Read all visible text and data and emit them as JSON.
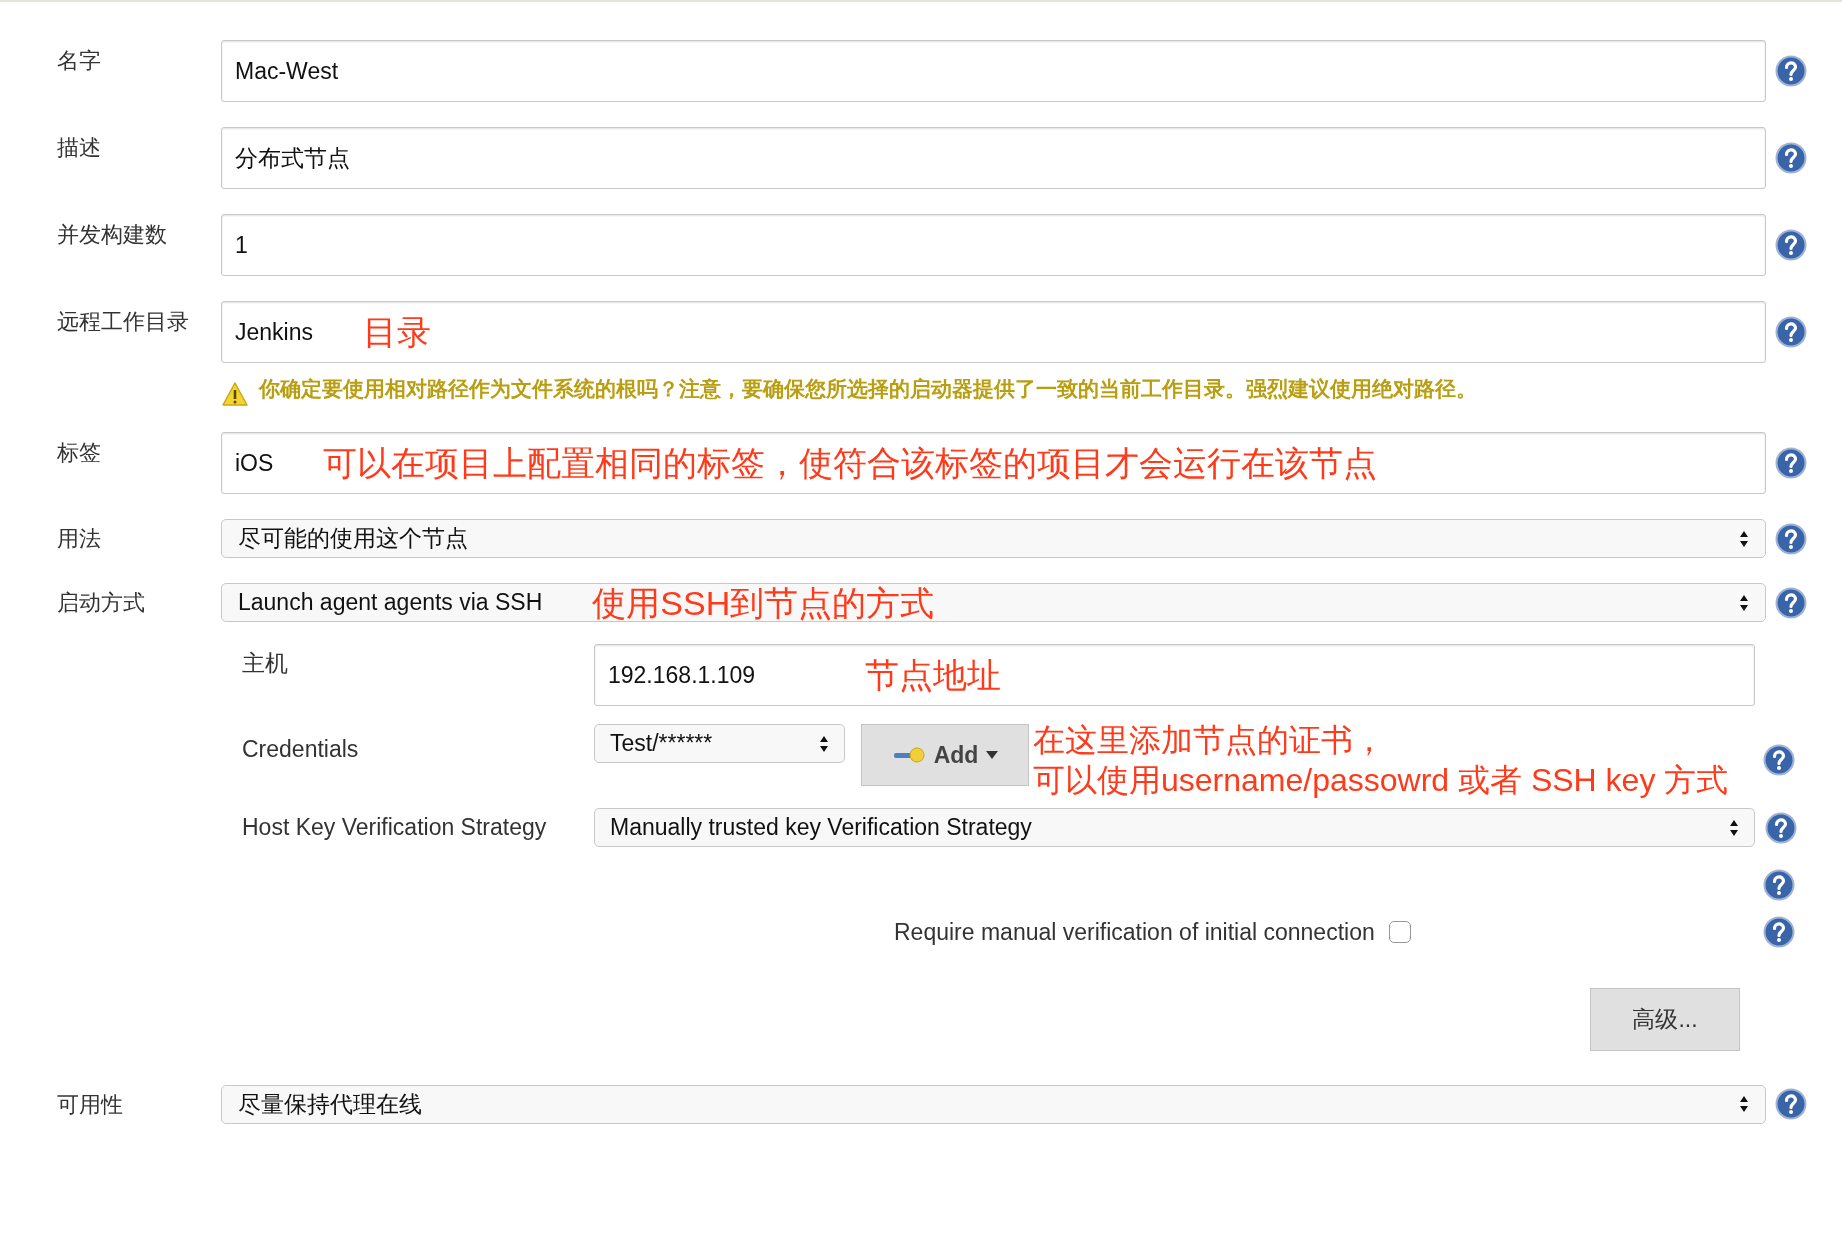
{
  "fields": [
    {
      "label": "名字",
      "kind": "text",
      "value": "Mac-West"
    },
    {
      "label": "描述",
      "kind": "text",
      "value": "分布式节点"
    },
    {
      "label": "并发构建数",
      "kind": "text",
      "value": "1"
    },
    {
      "label": "远程工作目录",
      "kind": "text",
      "value": "Jenkins",
      "annotation": "目录",
      "warning": "你确定要使用相对路径作为文件系统的根吗？注意，要确保您所选择的启动器提供了一致的当前工作目录。强烈建议使用绝对路径。"
    },
    {
      "label": "标签",
      "kind": "text",
      "value": "iOS",
      "annotation": "可以在项目上配置相同的标签，使符合该标签的项目才会运行在该节点"
    },
    {
      "label": "用法",
      "kind": "select",
      "value": "尽可能的使用这个节点"
    },
    {
      "label": "启动方式",
      "kind": "select",
      "value": "Launch agent agents via SSH",
      "annotation": "使用SSH到节点的方式"
    }
  ],
  "launch": {
    "host": {
      "label": "主机",
      "value": "192.168.1.109",
      "annotation": "节点地址"
    },
    "credentials": {
      "label": "Credentials",
      "value": "Test/******",
      "add_button": "Add",
      "annotation": [
        "在这里添加节点的证书，",
        "可以使用username/passowrd 或者 SSH key 方式"
      ]
    },
    "host_key": {
      "label": "Host Key Verification Strategy",
      "value": "Manually trusted key Verification Strategy"
    },
    "manual_verification": {
      "label": "Require manual verification of initial connection",
      "checked": false
    },
    "advanced_button": "高级..."
  },
  "availability": {
    "label": "可用性",
    "value": "尽量保持代理在线"
  }
}
